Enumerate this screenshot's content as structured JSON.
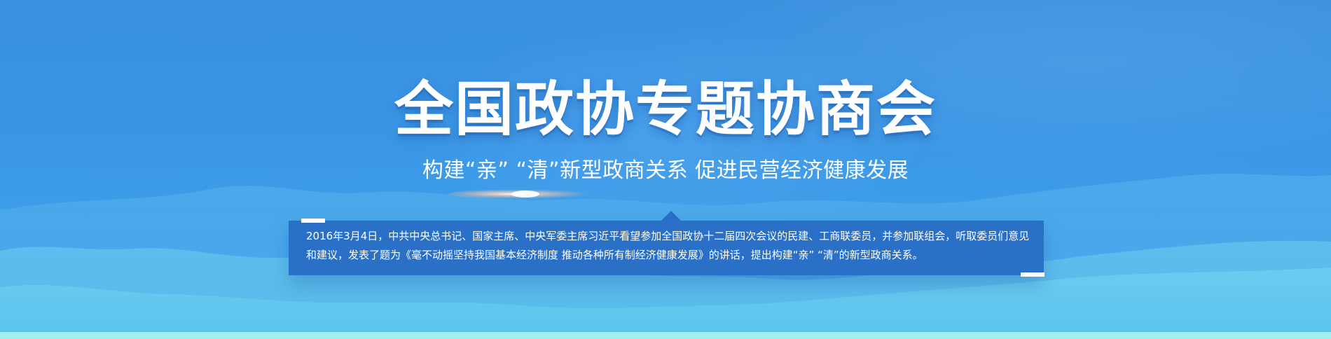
{
  "banner": {
    "title": "全国政协专题协商会",
    "subtitle": "构建“亲”  “清”新型政商关系 促进民营经济健康发展",
    "description": "2016年3月4日，中共中央总书记、国家主席、中央军委主席习近平看望参加全国政协十二届四次会议的民建、工商联委员，并参加联组会，听取委员们意见和建议，发表了题为《毫不动摇坚持我国基本经济制度 推动各种所有制经济健康发展》的讲话，提出构建“亲”  “清”的新型政商关系。"
  },
  "colors": {
    "background_top": "#3a90e0",
    "background_bottom": "#4eb4ec",
    "text_box": "#2a70c7",
    "accent": "#ffffff",
    "bottom_strip": "#9ff0ef"
  }
}
